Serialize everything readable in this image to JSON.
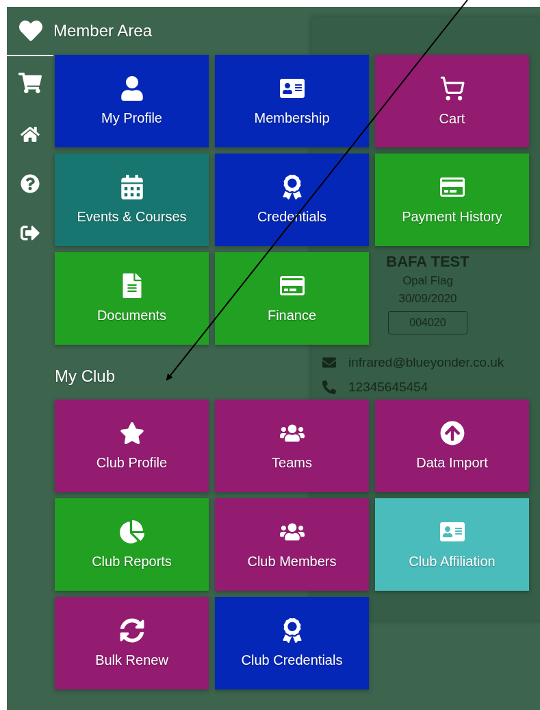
{
  "header": {
    "title": "Member Area"
  },
  "background_card": {
    "name": "BAFA TEST",
    "level_name": "Opal Flag",
    "date": "30/09/2020",
    "code": "004020",
    "email": "infrared@blueyonder.co.uk",
    "phone": "12345645454"
  },
  "sections": [
    {
      "tiles": [
        {
          "label": "My Profile",
          "color": "#0527b8"
        },
        {
          "label": "Membership",
          "color": "#0527b8"
        },
        {
          "label": "Cart",
          "color": "#931c70"
        },
        {
          "label": "Events & Courses",
          "color": "#187670"
        },
        {
          "label": "Credentials",
          "color": "#0527b8"
        },
        {
          "label": "Payment History",
          "color": "#22a022"
        },
        {
          "label": "Documents",
          "color": "#22a022"
        },
        {
          "label": "Finance",
          "color": "#22a022"
        }
      ]
    },
    {
      "title": "My Club",
      "tiles": [
        {
          "label": "Club Profile",
          "color": "#931c70"
        },
        {
          "label": "Teams",
          "color": "#931c70"
        },
        {
          "label": "Data Import",
          "color": "#931c70"
        },
        {
          "label": "Club Reports",
          "color": "#22a022"
        },
        {
          "label": "Club Members",
          "color": "#931c70"
        },
        {
          "label": "Club Affiliation",
          "color": "#4bbcbc"
        },
        {
          "label": "Bulk Renew",
          "color": "#931c70"
        },
        {
          "label": "Club Credentials",
          "color": "#0527b8"
        }
      ]
    }
  ]
}
